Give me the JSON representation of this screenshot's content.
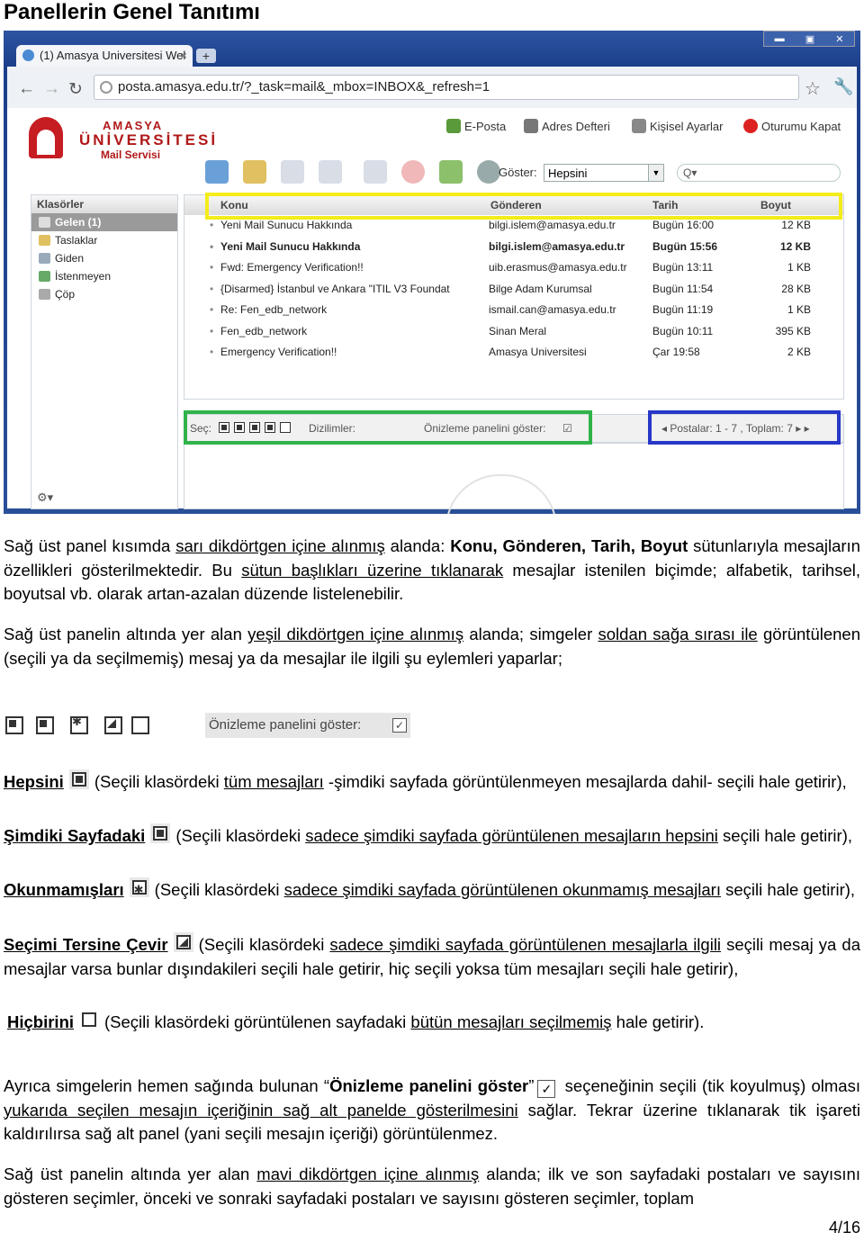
{
  "heading": "Panellerin Genel Tanıtımı",
  "browser": {
    "tab_title": "(1) Amasya Universitesi Wel",
    "tab_close": "×",
    "new_tab": "+",
    "window_buttons": [
      "▬",
      "▣",
      "✕"
    ],
    "url": "posta.amasya.edu.tr/?_task=mail&_mbox=INBOX&_refresh=1"
  },
  "logo": {
    "line1": "AMASYA",
    "line2": "ÜNİVERSİTESİ",
    "line3": "Mail Servisi"
  },
  "topmenu": [
    "E-Posta",
    "Adres Defteri",
    "Kişisel Ayarlar",
    "Oturumu Kapat"
  ],
  "toolbar": {
    "show_label": "Göster:",
    "show_value": "Hepsini",
    "search_placeholder": "Q▾"
  },
  "folders": {
    "title": "Klasörler",
    "items": [
      "Gelen (1)",
      "Taslaklar",
      "Giden",
      "İstenmeyen",
      "Çöp"
    ]
  },
  "message_list": {
    "columns": [
      "Konu",
      "Gönderen",
      "Tarih",
      "Boyut"
    ],
    "rows": [
      {
        "subject": "Yeni Mail Sunucu Hakkında",
        "from": "bilgi.islem@amasya.edu.tr",
        "date": "Bugün 16:00",
        "size": "12 KB",
        "unread": false
      },
      {
        "subject": "Yeni Mail Sunucu Hakkında",
        "from": "bilgi.islem@amasya.edu.tr",
        "date": "Bugün 15:56",
        "size": "12 KB",
        "unread": true
      },
      {
        "subject": "Fwd: Emergency Verification!!",
        "from": "uib.erasmus@amasya.edu.tr",
        "date": "Bugün 13:11",
        "size": "1 KB",
        "unread": false
      },
      {
        "subject": "{Disarmed} İstanbul ve Ankara \"ITIL V3 Foundat",
        "from": "Bilge Adam Kurumsal",
        "date": "Bugün 11:54",
        "size": "28 KB",
        "unread": false
      },
      {
        "subject": "Re: Fen_edb_network",
        "from": "ismail.can@amasya.edu.tr",
        "date": "Bugün 11:19",
        "size": "1 KB",
        "unread": false
      },
      {
        "subject": "Fen_edb_network",
        "from": "Sinan Meral",
        "date": "Bugün 10:11",
        "size": "395 KB",
        "unread": false
      },
      {
        "subject": "Emergency Verification!!",
        "from": "Amasya Universitesi",
        "date": "Çar 19:58",
        "size": "2 KB",
        "unread": false
      }
    ]
  },
  "statusbar": {
    "select_label": "Seç:",
    "threads_label": "Dizilimler:",
    "preview_label": "Önizleme panelini göster:",
    "paging": "Postalar: 1 - 7 , Toplam: 7"
  },
  "text": {
    "p1": {
      "a": "Sağ üst panel kısımda ",
      "u1": "sarı dikdörtgen içine alınmış",
      "b": " alanda: ",
      "bold": "Konu, Gönderen, Tarih, Boyut",
      "c": " sütunlarıyla mesajların özellikleri gösterilmektedir. Bu ",
      "u2": "sütun başlıkları üzerine tıklanarak",
      "d": " mesajlar istenilen biçimde; alfabetik, tarihsel, boyutsal vb. olarak artan-azalan düzende listelenebilir."
    },
    "p2": {
      "a": "Sağ üst panelin altında yer alan ",
      "u1": "yeşil dikdörtgen içine alınmış",
      "b": " alanda; simgeler ",
      "u2": "soldan sağa sırası ile",
      "c": " görüntülenen (seçili ya da seçilmemiş) mesaj ya da mesajlar ile ilgili şu eylemleri yaparlar;"
    },
    "preview_box": "Önizleme panelini göster:",
    "items": [
      {
        "term": "Hepsini",
        "a": "(Seçili klasördeki ",
        "u": "tüm mesajları",
        "b": " -şimdiki sayfada görüntülenmeyen mesajlarda dahil- seçili hale getirir),"
      },
      {
        "term": "Şimdiki Sayfadaki",
        "a": "(Seçili klasördeki ",
        "u": "sadece şimdiki sayfada görüntülenen mesajların hepsini",
        "b": " seçili hale getirir),"
      },
      {
        "term": "Okunmamışları",
        "a": "(Seçili klasördeki ",
        "u": "sadece şimdiki sayfada görüntülenen okunmamış mesajları",
        "b": " seçili hale getirir),"
      },
      {
        "term": "Seçimi Tersine Çevir",
        "a": "(Seçili klasördeki ",
        "u": "sadece şimdiki sayfada görüntülenen mesajlarla ilgili",
        "b": " seçili mesaj ya da mesajlar varsa bunlar dışındakileri seçili hale getirir, hiç seçili yoksa tüm mesajları seçili hale getirir),"
      },
      {
        "term": "Hiçbirini",
        "a": "(Seçili klasördeki görüntülenen sayfadaki ",
        "u": "bütün mesajları seçilmemiş",
        "b": " hale getirir)."
      }
    ],
    "p3": {
      "a": "Ayrıca simgelerin hemen sağında bulunan “",
      "bold": "Önizleme panelini göster",
      "b": "”",
      "c": " seçeneğinin seçili (tik koyulmuş) olması ",
      "u1": "yukarıda seçilen mesajın içeriğinin sağ alt panelde gösterilmesini",
      "d": " sağlar. Tekrar üzerine tıklanarak tik işareti kaldırılırsa sağ alt panel (yani seçili mesajın içeriği) görüntülenmez."
    },
    "p4": {
      "a": "Sağ üst panelin altında yer alan ",
      "u1": "mavi dikdörtgen içine alınmış",
      "b": " alanda; ilk ve son sayfadaki postaları ve sayısını gösteren seçimler, önceki ve sonraki sayfadaki postaları ve sayısını gösteren seçimler, toplam"
    },
    "page_number": "4/16"
  },
  "colors": {
    "yellow_box": "#f4ec1a",
    "green_box": "#2fb34a",
    "blue_box": "#2737c8",
    "brand_red": "#b01818"
  }
}
